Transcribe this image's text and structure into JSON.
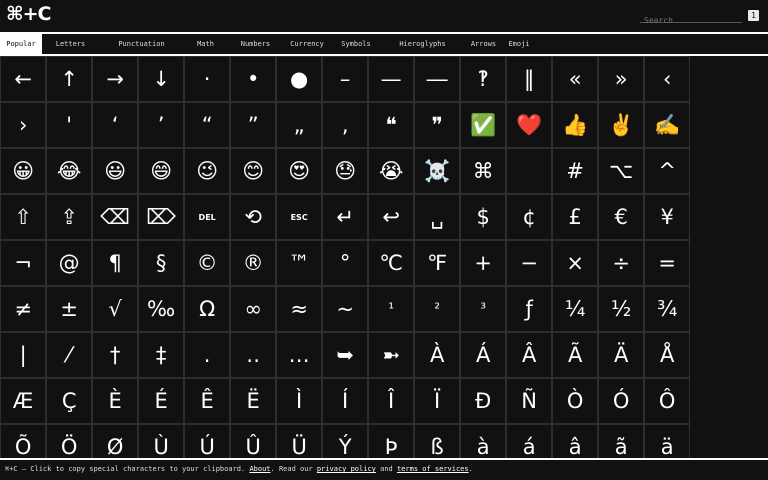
{
  "header": {
    "logo": "⌘+C",
    "search_placeholder": "Search",
    "shortcut_key": "1"
  },
  "tabs": [
    {
      "label": "Popular",
      "active": true
    },
    {
      "label": "Letters",
      "active": false
    },
    {
      "label": "Punctuation",
      "active": false
    },
    {
      "label": "Math",
      "active": false
    },
    {
      "label": "Numbers",
      "active": false
    },
    {
      "label": "Currency",
      "active": false
    },
    {
      "label": "Symbols",
      "active": false
    },
    {
      "label": "Hieroglyphs",
      "active": false
    },
    {
      "label": "Arrows",
      "active": false
    },
    {
      "label": "Emoji",
      "active": false
    }
  ],
  "grid": [
    "←",
    "↑",
    "→",
    "↓",
    "·",
    "•",
    "●",
    "–",
    "—",
    "―",
    "‽",
    "‖",
    "«",
    "»",
    "‹",
    "›",
    "'",
    "‘",
    "’",
    "“",
    "”",
    "„",
    "‚",
    "❝",
    "❞",
    "✅",
    "❤️",
    "👍",
    "✌️",
    "✍️",
    "😀",
    "😂",
    "😃",
    "😄",
    "😉",
    "😊",
    "😍",
    "😓",
    "😭",
    "☠️",
    "⌘",
    "",
    "#",
    "⌥",
    "^",
    "⇧",
    "⇪",
    "⌫",
    "⌦",
    "DEL",
    "⟲",
    "ESC",
    "↵",
    "↩",
    "␣",
    "$",
    "¢",
    "£",
    "€",
    "¥",
    "¬",
    "@",
    "¶",
    "§",
    "©",
    "®",
    "™",
    "°",
    "℃",
    "℉",
    "+",
    "−",
    "×",
    "÷",
    "=",
    "≠",
    "±",
    "√",
    "‰",
    "Ω",
    "∞",
    "≈",
    "~",
    "¹",
    "²",
    "³",
    "ƒ",
    "¼",
    "½",
    "¾",
    "|",
    "⁄",
    "†",
    "‡",
    ".",
    "‥",
    "…",
    "➥",
    "➼",
    "À",
    "Á",
    "Â",
    "Ã",
    "Ä",
    "Å",
    "Æ",
    "Ç",
    "È",
    "É",
    "Ê",
    "Ë",
    "Ì",
    "Í",
    "Î",
    "Ï",
    "Ð",
    "Ñ",
    "Ò",
    "Ó",
    "Ô",
    "Õ",
    "Ö",
    "Ø",
    "Ù",
    "Ú",
    "Û",
    "Ü",
    "Ý",
    "Þ",
    "ß",
    "à",
    "á",
    "â",
    "ã",
    "ä"
  ],
  "footer": {
    "prefix": "⌘+C — Click to copy special characters to your clipboard. ",
    "about_link": "About",
    "middle": ". Read our ",
    "privacy_link": "privacy policy",
    "and": " and ",
    "terms_link": "terms of services",
    "suffix": "."
  }
}
